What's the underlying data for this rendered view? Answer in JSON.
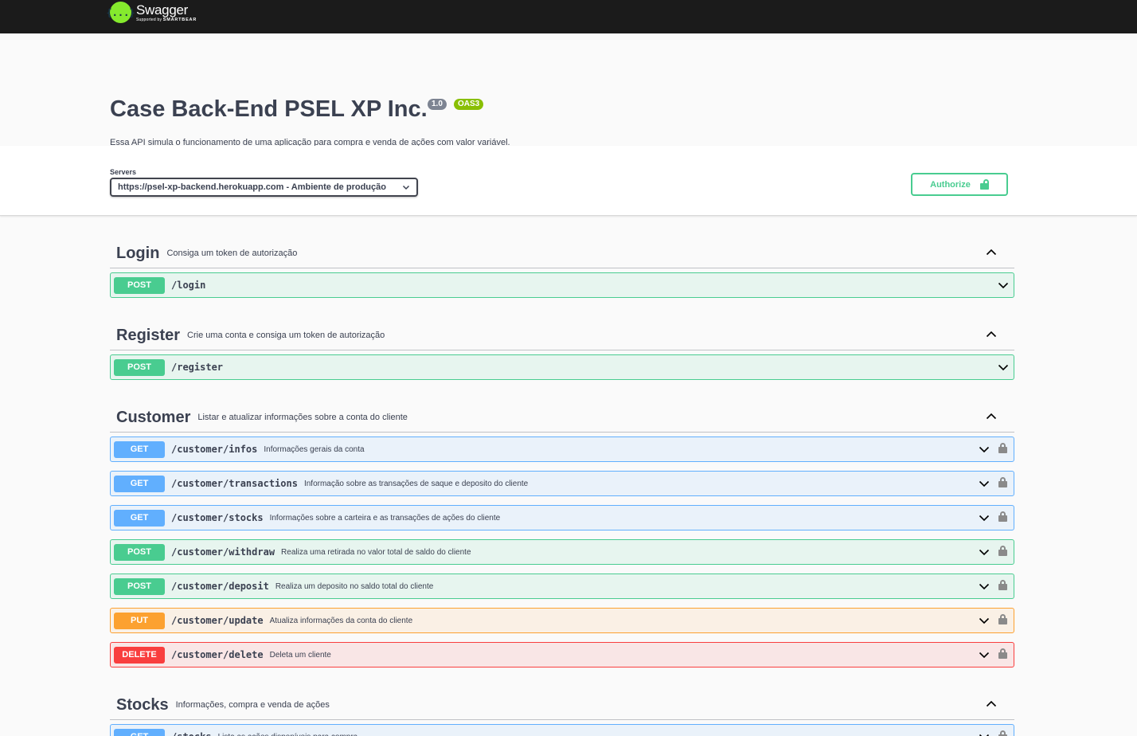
{
  "topbar": {
    "logo_glyph": "{...}",
    "logo_title": "Swagger",
    "logo_supported": "Supported by",
    "logo_brand": "SMARTBEAR"
  },
  "info": {
    "title": "Case Back-End PSEL XP Inc.",
    "version": "1.0",
    "oas_badge": "OAS3",
    "description": "Essa API simula o funcionamento de uma aplicação para compra e venda de ações com valor variável."
  },
  "servers": {
    "label": "Servers",
    "selected": "https://psel-xp-backend.herokuapp.com - Ambiente de produção"
  },
  "authorize": {
    "label": "Authorize"
  },
  "colors": {
    "post": "#49cc90",
    "get": "#61affe",
    "put": "#fca130",
    "delete": "#f93e3e"
  },
  "tags": [
    {
      "name": "Login",
      "description": "Consiga um token de autorização",
      "operations": [
        {
          "method": "POST",
          "path": "/login",
          "summary": "",
          "locked": false
        }
      ]
    },
    {
      "name": "Register",
      "description": "Crie uma conta e consiga um token de autorização",
      "operations": [
        {
          "method": "POST",
          "path": "/register",
          "summary": "",
          "locked": false
        }
      ]
    },
    {
      "name": "Customer",
      "description": "Listar e atualizar informações sobre a conta do cliente",
      "operations": [
        {
          "method": "GET",
          "path": "/customer/infos",
          "summary": "Informações gerais da conta",
          "locked": true
        },
        {
          "method": "GET",
          "path": "/customer/transactions",
          "summary": "Informação sobre as transações de saque e deposito do cliente",
          "locked": true
        },
        {
          "method": "GET",
          "path": "/customer/stocks",
          "summary": "Informações sobre a carteira e as transações de ações do cliente",
          "locked": true
        },
        {
          "method": "POST",
          "path": "/customer/withdraw",
          "summary": "Realiza uma retirada no valor total de saldo do cliente",
          "locked": true
        },
        {
          "method": "POST",
          "path": "/customer/deposit",
          "summary": "Realiza um deposito no saldo total do cliente",
          "locked": true
        },
        {
          "method": "PUT",
          "path": "/customer/update",
          "summary": "Atualiza informações da conta do cliente",
          "locked": true
        },
        {
          "method": "DELETE",
          "path": "/customer/delete",
          "summary": "Deleta um cliente",
          "locked": true
        }
      ]
    },
    {
      "name": "Stocks",
      "description": "Informações, compra e venda de ações",
      "operations": [
        {
          "method": "GET",
          "path": "/stocks",
          "summary": "Lista as ações disponíveis para compra",
          "locked": true
        }
      ]
    }
  ]
}
